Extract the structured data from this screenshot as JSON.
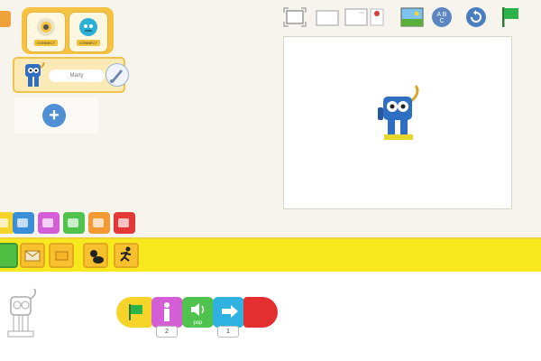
{
  "sprites": {
    "connect_buttons": [
      {
        "label": "CONNECT",
        "color": "#e7e2c8",
        "icon": "marty-head-icon"
      },
      {
        "label": "CONNECT",
        "color": "#2bb0d6",
        "icon": "cog-robot-icon"
      }
    ],
    "selected_sprite": {
      "name": "Marty",
      "icon": "marty-robot-icon"
    },
    "add_icon": "+"
  },
  "stage": {
    "toolbar_icons": [
      "fullscreen-icon",
      "grid-small-icon",
      "card-icon",
      "flag-page-icon",
      "background-icon",
      "text-abc-icon",
      "reset-icon",
      "green-flag-icon"
    ],
    "character": "marty-robot-icon"
  },
  "categories": [
    {
      "name": "triggers",
      "color": "#f7d42a"
    },
    {
      "name": "motion",
      "color": "#3b8ed8"
    },
    {
      "name": "looks",
      "color": "#d35ed6"
    },
    {
      "name": "sound",
      "color": "#4fc34d"
    },
    {
      "name": "control",
      "color": "#f49a35"
    },
    {
      "name": "end",
      "color": "#e43737"
    }
  ],
  "palette": [
    "start-on-flag-icon",
    "message-envelope-icon",
    "message-send-icon",
    "bump-icon",
    "run-away-icon"
  ],
  "script": {
    "blocks": [
      {
        "name": "green-flag-block",
        "color": "#f7d42a"
      },
      {
        "name": "jump-block",
        "color": "#d35ed6",
        "param": "2"
      },
      {
        "name": "sound-pop-block",
        "color": "#4fc34d",
        "label": "pop"
      },
      {
        "name": "move-right-block",
        "color": "#2fb2e0",
        "param": "1"
      },
      {
        "name": "end-block",
        "color": "#e32f2f"
      }
    ]
  }
}
